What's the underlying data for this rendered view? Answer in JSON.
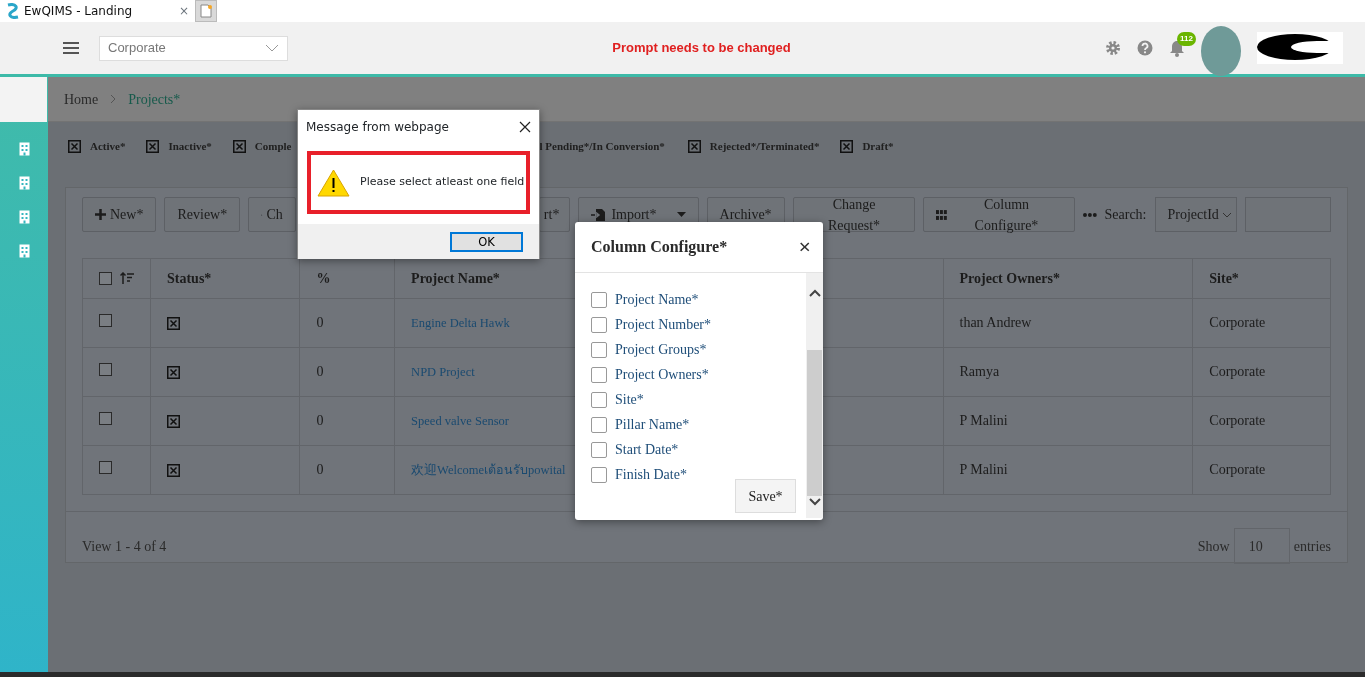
{
  "browser_tab": {
    "title": "EwQIMS - Landing",
    "close": "×"
  },
  "header": {
    "site_select": "Corporate",
    "prompt": "Prompt needs to be changed",
    "notification_count": "112"
  },
  "breadcrumb": [
    {
      "label": "Home"
    },
    {
      "label": "Projects*"
    }
  ],
  "status_filters": [
    {
      "label": "Active*",
      "checked": true
    },
    {
      "label": "Inactive*",
      "checked": true
    },
    {
      "label": "Comple",
      "checked": true
    },
    {
      "label": "l Pending*/In Conversion*"
    },
    {
      "label": "Rejected*/Terminated*",
      "checked": true
    },
    {
      "label": "Draft*",
      "checked": true
    }
  ],
  "toolbar": {
    "buttons": [
      {
        "label": "New*",
        "kind": "plus"
      },
      {
        "label": "Review*",
        "kind": "plain"
      },
      {
        "label": "Ch",
        "kind": "chart"
      },
      {
        "label": "rt*",
        "kind": "plain"
      },
      {
        "label": "Import*",
        "kind": "import"
      },
      {
        "label": "Archive*",
        "kind": "plain"
      },
      {
        "label": "Change Request*",
        "kind": "plain"
      },
      {
        "label": "Column Configure*",
        "kind": "grid"
      }
    ],
    "search_label": "Search:",
    "search_select": "ProjectId"
  },
  "table": {
    "all_selected": false,
    "columns": [
      "Status*",
      "%",
      "Project Name*",
      "Project Owners*",
      "Site*"
    ],
    "rows": [
      {
        "selected": false,
        "status_checked": true,
        "percent": "0",
        "project_name": "Engine Delta Hawk",
        "project_owners": "than Andrew",
        "site": "Corporate"
      },
      {
        "selected": false,
        "status_checked": true,
        "percent": "0",
        "project_name": "NPD Project",
        "project_owners": "Ramya",
        "site": "Corporate"
      },
      {
        "selected": false,
        "status_checked": true,
        "percent": "0",
        "project_name": "Speed valve Sensor",
        "project_owners": "P Malini",
        "site": "Corporate"
      },
      {
        "selected": false,
        "status_checked": true,
        "percent": "0",
        "project_name": "欢迎Welcomeเต้อนรับpowital",
        "project_owners": "P Malini",
        "site": "Corporate"
      }
    ]
  },
  "pager": {
    "summary": "View 1 - 4 of 4",
    "show": "Show",
    "page_size": "10",
    "entries": "entries"
  },
  "column_configure": {
    "title": "Column Configure*",
    "close": "×",
    "items": [
      {
        "label": "Project Name*",
        "checked": false
      },
      {
        "label": "Project Number*",
        "checked": false
      },
      {
        "label": "Project Groups*",
        "checked": false
      },
      {
        "label": "Project Owners*",
        "checked": false
      },
      {
        "label": "Site*",
        "checked": false
      },
      {
        "label": "Pillar Name*",
        "checked": false
      },
      {
        "label": "Start Date*",
        "checked": false
      },
      {
        "label": "Finish Date*",
        "checked": false
      }
    ],
    "save": "Save*"
  },
  "message_dialog": {
    "title": "Message from webpage",
    "message": "Please select atleast one field",
    "ok": "OK"
  }
}
